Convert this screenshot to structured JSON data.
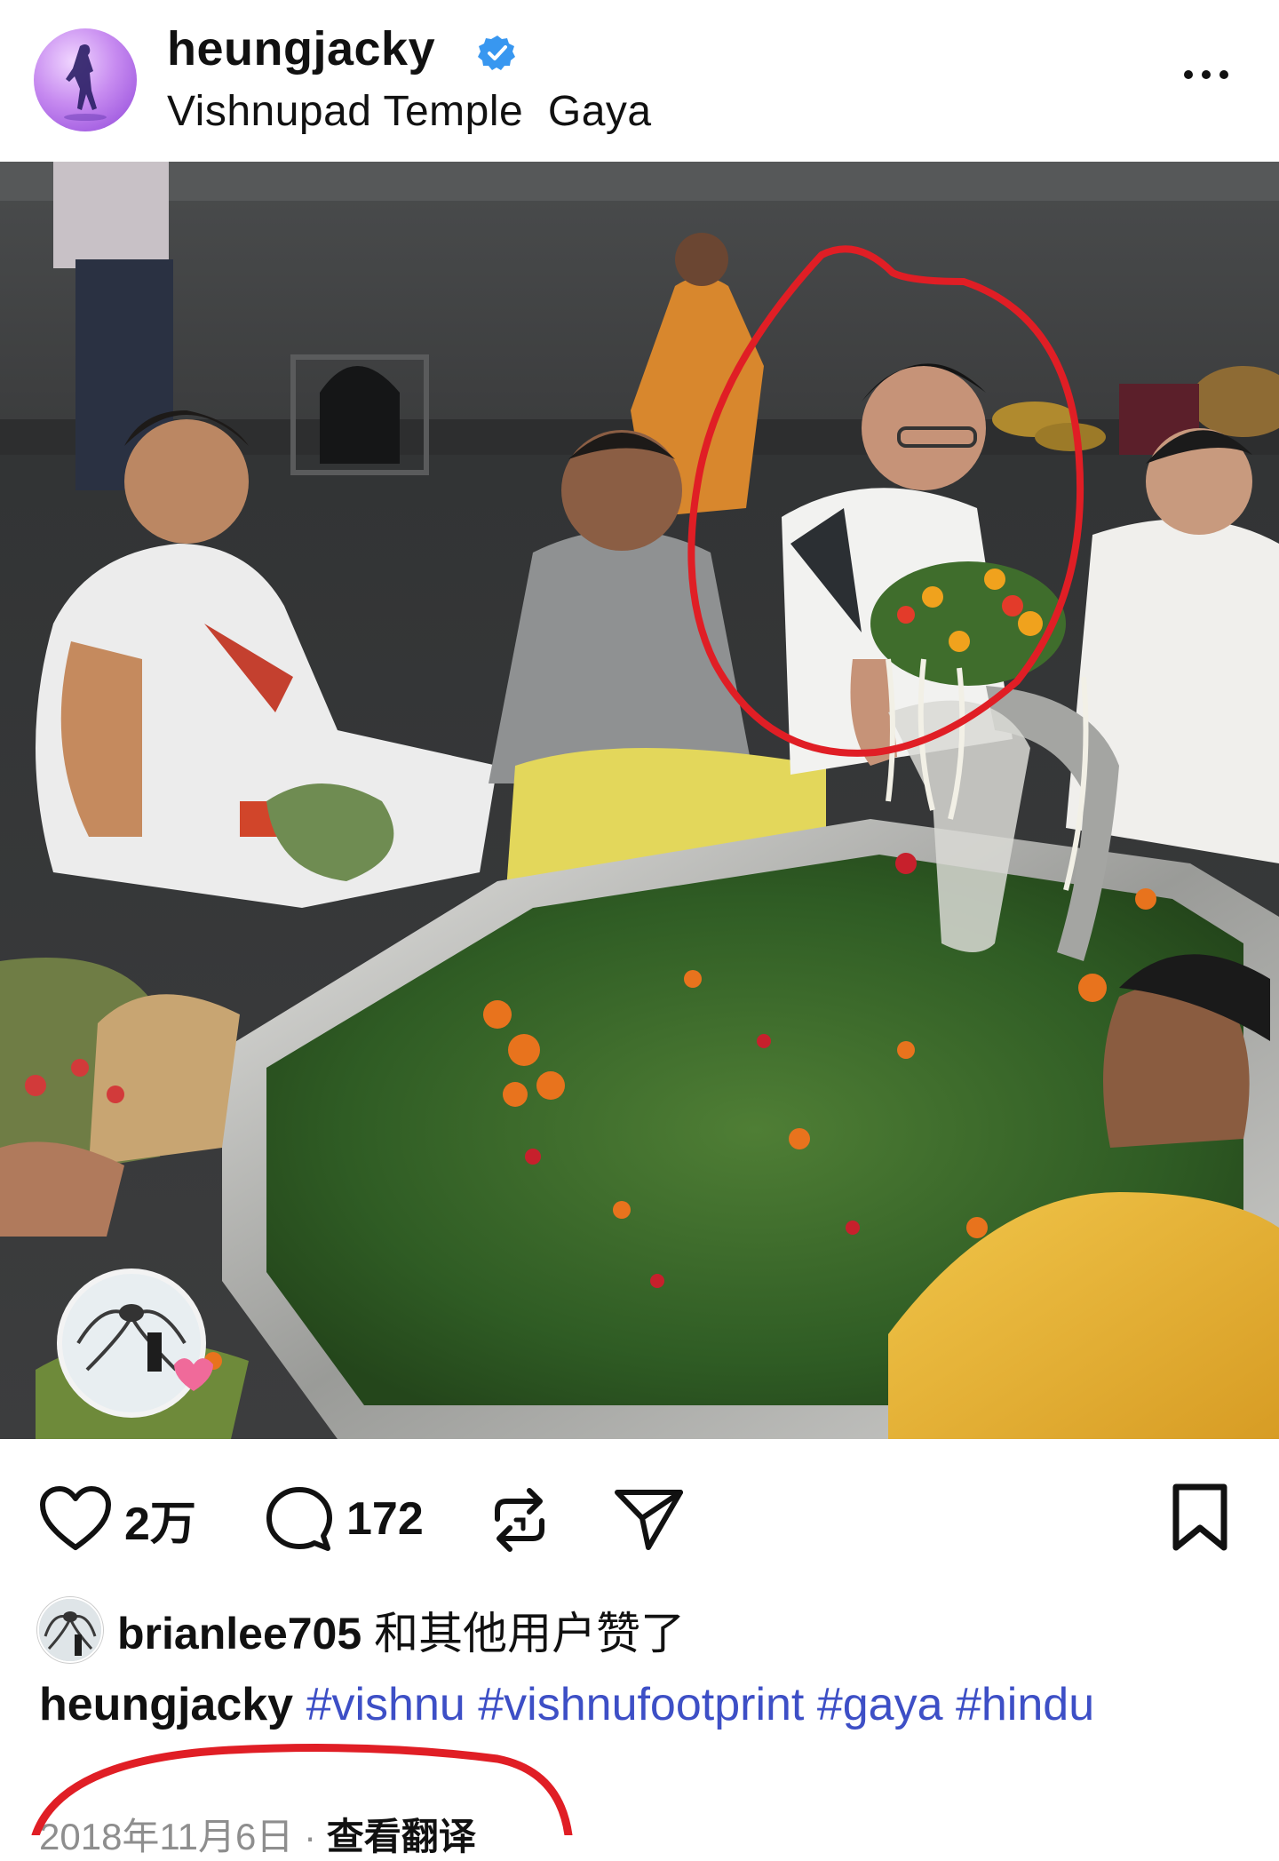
{
  "post": {
    "username": "heungjacky",
    "location": "Vishnupad Temple  Gaya"
  },
  "actions": {
    "likes": "2万",
    "comments": "172"
  },
  "liked_by": {
    "user": "brianlee705",
    "suffix": "和其他用户赞了"
  },
  "caption": {
    "username": "heungjacky",
    "hashtags": [
      "#vishnu",
      "#vishnufootprint",
      "#gaya",
      "#hindu"
    ]
  },
  "footer": {
    "date": "2018年11月6日",
    "separator": "·",
    "translate": "查看翻译"
  },
  "icons": [
    "verified-badge-icon",
    "more-options-icon",
    "heart-icon",
    "comment-icon",
    "repost-icon",
    "share-icon",
    "bookmark-icon"
  ],
  "colors": {
    "verified": "#3897f0",
    "hashtag": "#3d4fc6",
    "annotation": "#e01e25",
    "secondary_text": "#8e8e8e"
  }
}
